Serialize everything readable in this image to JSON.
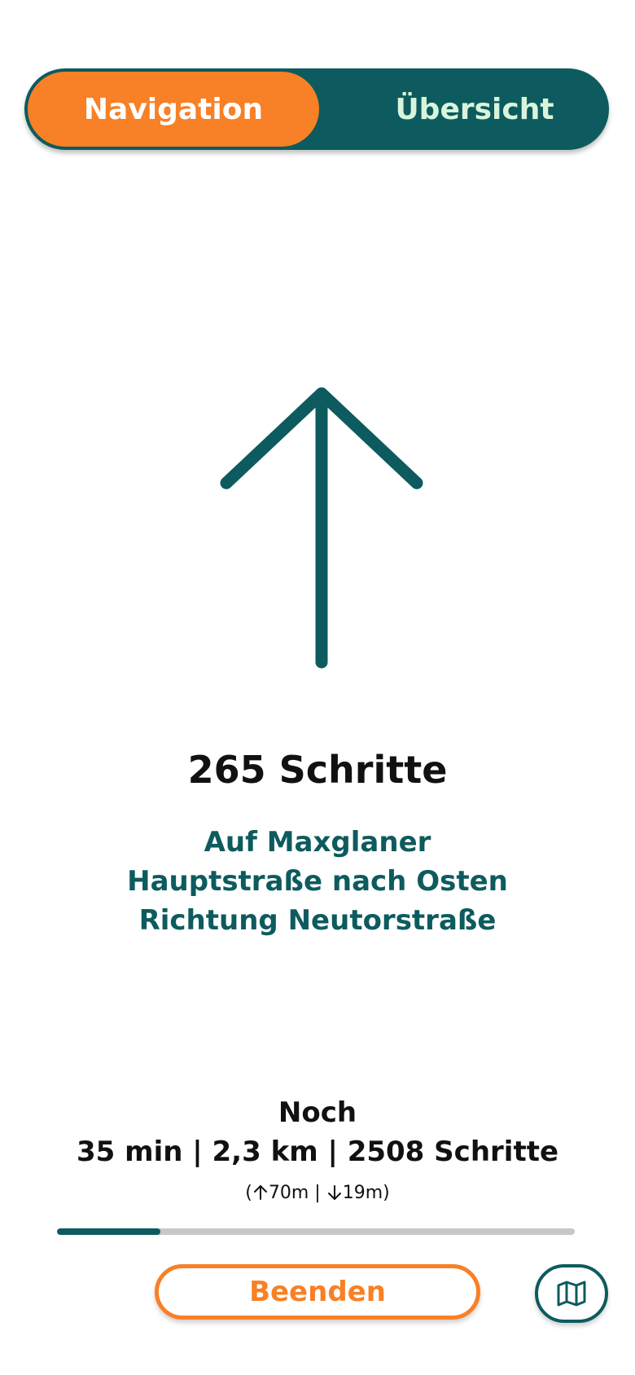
{
  "tabs": {
    "navigation": "Navigation",
    "overview": "Übersicht",
    "active": "navigation"
  },
  "direction_icon": "arrow-up-icon",
  "maneuver": {
    "steps": "265 Schritte",
    "instruction_line1": "Auf Maxglaner",
    "instruction_line2": "Hauptstraße nach Osten",
    "instruction_line3": "Richtung Neutorstraße"
  },
  "remaining": {
    "label": "Noch",
    "stats": "35 min | 2,3 km | 2508 Schritte",
    "elevation_open": "(",
    "elevation_up_icon": "arrow-up-small-icon",
    "elevation_up": "70m",
    "elevation_sep": " | ",
    "elevation_down_icon": "arrow-down-small-icon",
    "elevation_down": "19m",
    "elevation_close": ")"
  },
  "progress": {
    "fraction": 0.2
  },
  "actions": {
    "end_label": "Beenden",
    "map_icon": "map-icon"
  },
  "colors": {
    "primary": "#0d5b5e",
    "accent": "#f88026",
    "tab_inactive_text": "#d8f5dc"
  }
}
